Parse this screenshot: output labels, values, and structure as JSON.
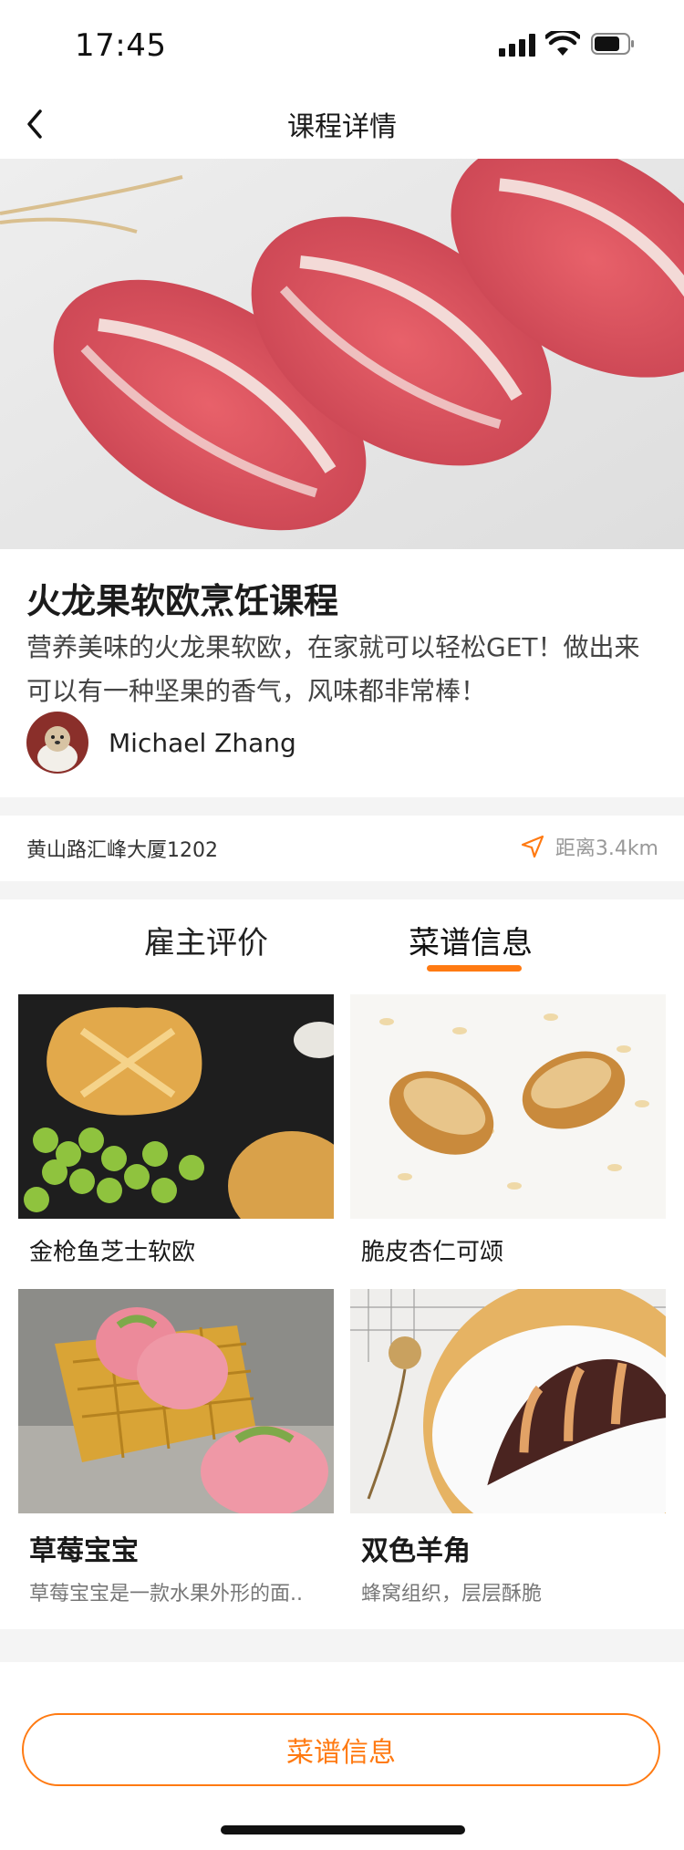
{
  "status_bar": {
    "time": "17:45"
  },
  "nav": {
    "title": "课程详情",
    "back_icon": "chevron-left-icon"
  },
  "course": {
    "title": "火龙果软欧烹饪课程",
    "description": "营养美味的火龙果软欧，在家就可以轻松GET！做出来可以有一种坚果的香气，风味都非常棒！",
    "author_name": "Michael Zhang"
  },
  "location": {
    "address": "黄山路汇峰大厦1202",
    "distance": "距离3.4km"
  },
  "tabs": [
    {
      "label": "雇主评价",
      "active": false
    },
    {
      "label": "菜谱信息",
      "active": true
    }
  ],
  "recipes": [
    {
      "title": "金枪鱼芝士软欧"
    },
    {
      "title": "脆皮杏仁可颂"
    },
    {
      "title": "草莓宝宝",
      "subtitle": "草莓宝宝是一款水果外形的面.."
    },
    {
      "title": "双色羊角",
      "subtitle": "蜂窝组织，层层酥脆"
    }
  ],
  "bottom_button": {
    "label": "菜谱信息"
  },
  "colors": {
    "accent": "#ff7a12",
    "separator": "#f4f4f4"
  }
}
